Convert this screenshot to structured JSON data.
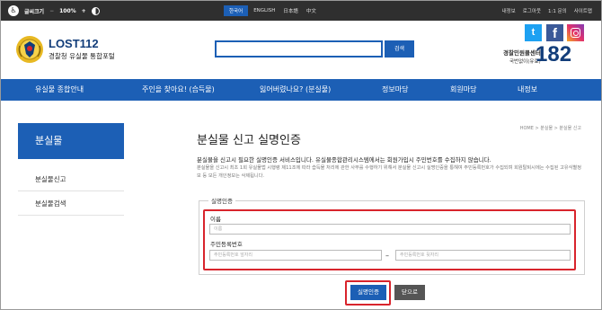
{
  "topbar": {
    "accessibility_label": "글씨크기",
    "zoom_out": "−",
    "zoom_level": "100%",
    "zoom_in": "+",
    "languages": [
      "한국어",
      "ENGLISH",
      "日本語",
      "中文"
    ],
    "utilities": [
      "내정보",
      "로그아웃",
      "1:1 문의",
      "사이트맵"
    ]
  },
  "header": {
    "logo_name": "LOST112",
    "logo_subtitle": "경찰청 유실물 통합포털",
    "search_placeholder": "",
    "search_button": "검색",
    "social": {
      "twitter": "t",
      "facebook": "f"
    },
    "center_label": "경찰민원콜센터",
    "center_sub": "국번없이(유료)",
    "center_number": "182"
  },
  "nav": {
    "items": [
      "유실물 종합안내",
      "주인을 찾아요! (습득물)",
      "잃어버렸나요? (분실물)",
      "정보마당",
      "회원마당",
      "내정보"
    ]
  },
  "sidebar": {
    "title": "분실물",
    "items": [
      "분실물신고",
      "분실물검색"
    ]
  },
  "main": {
    "title": "분실물 신고 실명인증",
    "breadcrumb": "HOME > 분실물 > 분실물 신고",
    "intro_main": "분실물을 신고시 필요한 실명인증 서비스입니다. 유실물종합관리시스템에서는 회원가입시 주민번호를 수집하지 않습니다.",
    "intro_detail": "분실물을 신고시 최초 1회 유실물법 시행령 제11조에 따라 습득물 처리에 관한 사무를 수행하기 위해서 분실물 신고시 실명인증을 통해여 주민등록번호가 수집되며 회원탈퇴시에는 수집된 고유식별정보 등 모든 개인정보는 삭제됩니다.",
    "legend": "실명인증",
    "form": {
      "name_label": "이름",
      "name_placeholder": "이름",
      "rrn_label": "주민등록번호",
      "rrn_front_placeholder": "주민등록번호 앞자리",
      "rrn_dash": "–",
      "rrn_back_placeholder": "주민등록번호 뒷자리"
    },
    "buttons": {
      "verify": "실명인증",
      "close": "닫으로"
    }
  },
  "colors": {
    "primary": "#1c5fb5",
    "highlight": "#d8242c",
    "topbar": "#2f2f2f",
    "logo": "#123d7a"
  }
}
